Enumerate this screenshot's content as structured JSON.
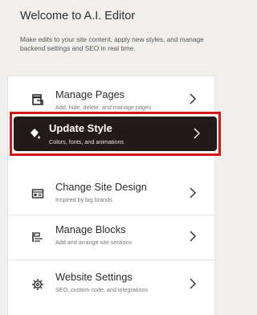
{
  "header": {
    "title": "Welcome to A.I. Editor",
    "description": "Make edits to your site content, apply new styles, and manage backend settings and SEO in real time."
  },
  "menu": {
    "items": [
      {
        "label": "Manage Pages",
        "sub": "Add, hide, delete, and manage pages",
        "icon": "pages-icon"
      },
      {
        "label": "Update Style",
        "sub": "Colors, fonts, and animations",
        "icon": "paint-bucket-icon",
        "active": true
      },
      {
        "label": "Change Site Design",
        "sub": "Inspired by big brands",
        "icon": "layout-icon"
      },
      {
        "label": "Manage Blocks",
        "sub": "Add and arrange site sections",
        "icon": "blocks-icon"
      },
      {
        "label": "Website Settings",
        "sub": "SEO, custom code, and integrations",
        "icon": "gear-icon"
      }
    ]
  },
  "colors": {
    "background": "#f1efed",
    "active_item": "#231b1a",
    "highlight_border": "#d21818"
  }
}
